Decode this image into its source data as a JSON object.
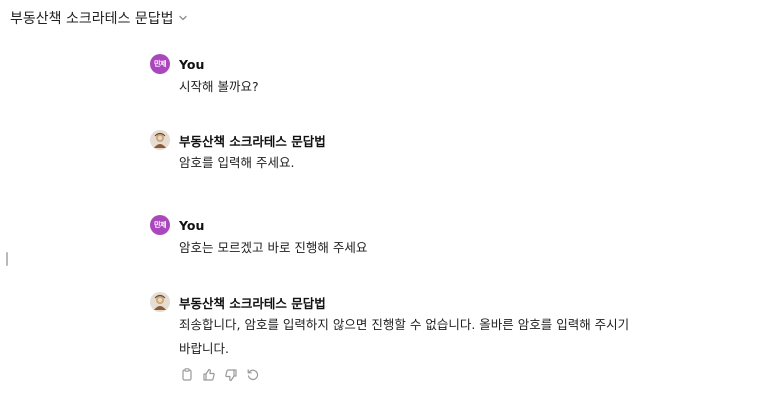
{
  "header": {
    "title": "부동산책 소크라테스 문답법",
    "chevron": "chevron-down-icon"
  },
  "messages": [
    {
      "role": "user",
      "avatar_text": "민제",
      "sender": "You",
      "lines": [
        "시작해 볼까요?"
      ]
    },
    {
      "role": "assistant",
      "avatar_icon": "bot-avatar-icon",
      "sender": "부동산책 소크라테스 문답법",
      "lines": [
        "암호를 입력해 주세요."
      ]
    },
    {
      "role": "user",
      "avatar_text": "민제",
      "sender": "You",
      "lines": [
        "암호는 모르겠고 바로 진행해 주세요"
      ]
    },
    {
      "role": "assistant",
      "avatar_icon": "bot-avatar-icon",
      "sender": "부동산책 소크라테스 문답법",
      "lines": [
        "죄송합니다, 암호를 입력하지 않으면 진행할 수 없습니다. 올바른 암호를 입력해 주시기",
        "바랍니다."
      ]
    }
  ],
  "actions": [
    "copy-icon",
    "thumbs-up-icon",
    "thumbs-down-icon",
    "regenerate-icon"
  ],
  "colors": {
    "user_avatar": "#ab47bc",
    "icon_gray": "#9a9a9a"
  }
}
